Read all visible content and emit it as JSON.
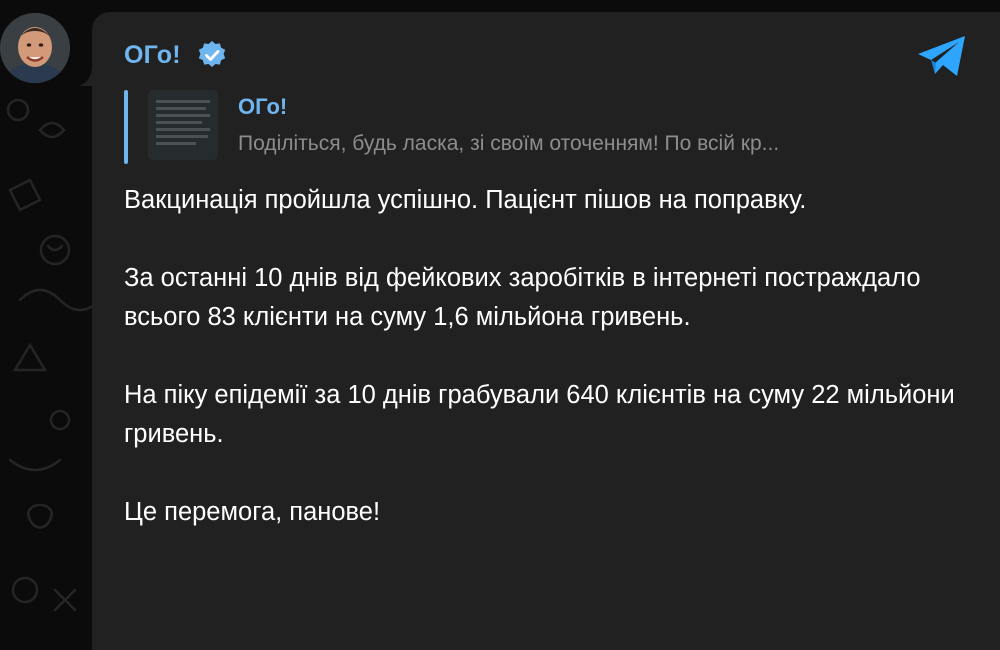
{
  "channel": {
    "name": "ОГо!",
    "avatar_icon": "avatar-photo",
    "verified_icon": "verified-badge-icon",
    "share_icon": "telegram-plane-icon"
  },
  "reply": {
    "title": "ОГо!",
    "text": "Поділіться, будь ласка, зі своїм оточенням! По всій кр..."
  },
  "message": {
    "paragraphs": [
      "Вакцинація пройшла успішно. Пацієнт пішов на поправку.",
      "За останні 10 днів від фейкових заробітків в інтернеті постраждало всього 83 клієнти на суму 1,6 мільйона гривень.",
      "На піку епідемії за 10 днів грабували 640 клієнтів на суму 22 мільйони гривень.",
      "Це перемога, панове!"
    ]
  },
  "colors": {
    "accent": "#6fb6f0",
    "bubble": "#212121",
    "background": "#0b0b0b",
    "text": "#ffffff",
    "muted": "#8d8d8d",
    "telegram_blue": "#2ea6ff"
  }
}
